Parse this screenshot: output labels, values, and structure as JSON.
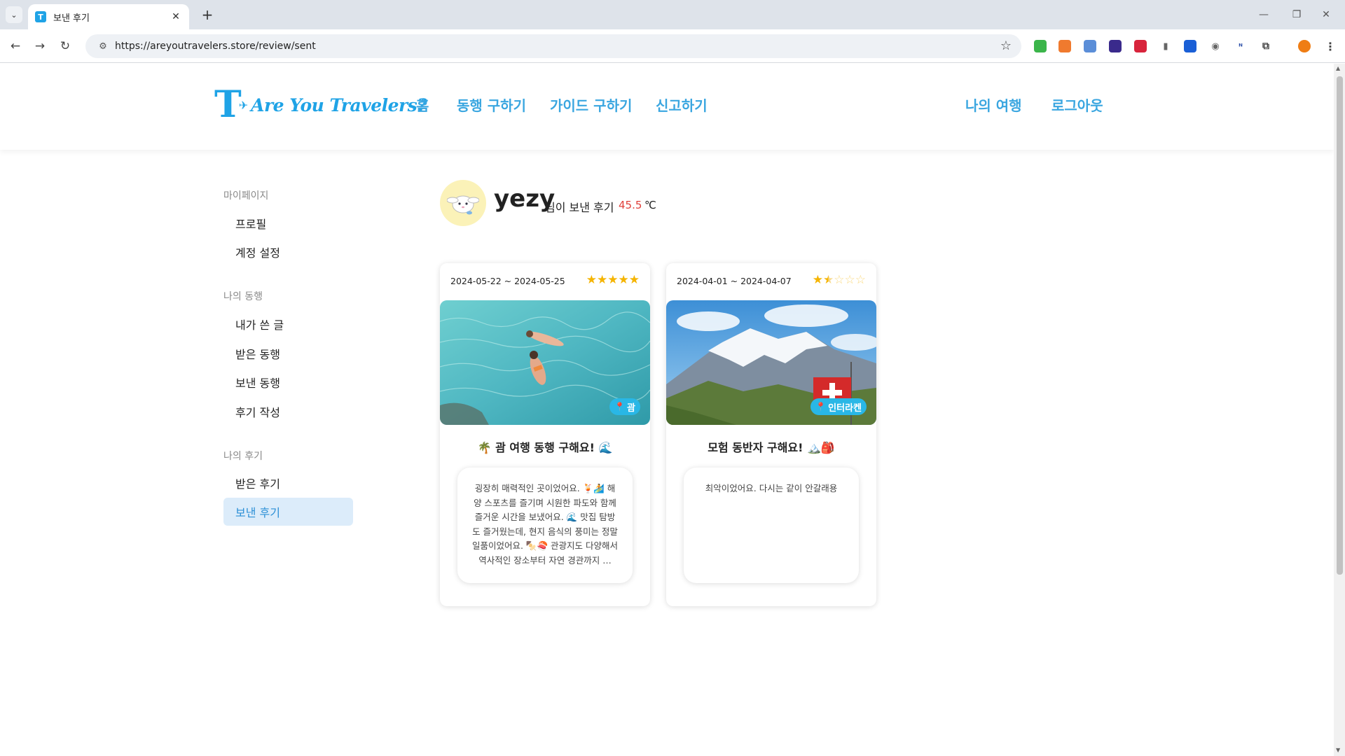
{
  "browser": {
    "tab_title": "보낸 후기",
    "tab_favicon_letter": "T",
    "url": "https://areyoutravelers.store/review/sent",
    "menu_glyph": "⌄",
    "close_glyph": "✕",
    "new_tab_glyph": "+",
    "window_controls": {
      "minimize": "—",
      "restore": "❐",
      "close": "✕"
    },
    "nav": {
      "back": "←",
      "forward": "→",
      "reload": "↻"
    },
    "star_glyph": "☆",
    "menu_dots": "⋮"
  },
  "header": {
    "logo_letter": "T",
    "logo_text": "Are You Travelers?",
    "nav": [
      "홈",
      "동행 구하기",
      "가이드 구하기",
      "신고하기"
    ],
    "right_nav": [
      "나의 여행",
      "로그아웃"
    ]
  },
  "sidebar": {
    "groups": [
      {
        "label": "마이페이지",
        "items": [
          "프로필",
          "계정 설정"
        ]
      },
      {
        "label": "나의 동행",
        "items": [
          "내가 쓴 글",
          "받은 동행",
          "보낸 동행",
          "후기 작성"
        ]
      },
      {
        "label": "나의 후기",
        "items": [
          "받은 후기",
          "보낸 후기"
        ]
      }
    ],
    "active_item": "보낸 후기"
  },
  "profile": {
    "name": "yezy",
    "suffix": "님이 보낸 후기",
    "temperature": "45.5",
    "temperature_unit": "℃"
  },
  "reviews": [
    {
      "date_range": "2024-05-22 ~ 2024-05-25",
      "rating": 5,
      "location": "괌",
      "title": "🌴 괌 여행 동행 구해요! 🌊",
      "body": "굉장히 매력적인 곳이었어요. 🍹🏄 해양 스포츠를 즐기며 시원한 파도와 함께 즐거운 시간을 보냈어요. 🌊 맛집 탐방도 즐거웠는데, 현지 음식의 풍미는 정말 일품이었어요. 🍢🍣 관광지도 다양해서 역사적인 장소부터 자연 경관까지 …"
    },
    {
      "date_range": "2024-04-01 ~ 2024-04-07",
      "rating": 1.5,
      "location": "인터라켄",
      "title": "모험 동반자 구해요! 🏔️🎒",
      "body": "최악이었어요. 다시는 같이 안갈래용"
    }
  ],
  "colors": {
    "brand": "#1fa3e6",
    "nav_link": "#3aa6e0",
    "temperature": "#e0403a",
    "star": "#f5b400",
    "active_bg": "#dcecfa"
  }
}
